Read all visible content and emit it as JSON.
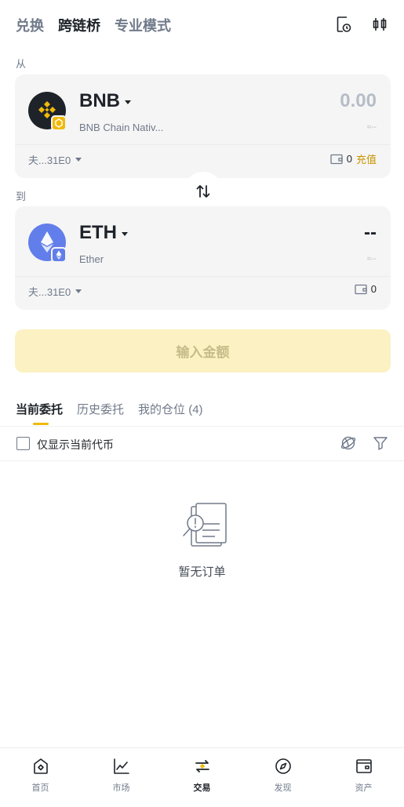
{
  "header": {
    "tabs": [
      {
        "label": "兑换",
        "active": false
      },
      {
        "label": "跨链桥",
        "active": true
      },
      {
        "label": "专业模式",
        "active": false
      }
    ],
    "icons": [
      "order-history-icon",
      "candlestick-chart-icon"
    ]
  },
  "from": {
    "label": "从",
    "symbol": "BNB",
    "chain_name": "BNB Chain Nativ...",
    "amount": "0.00",
    "approx": "≈--",
    "address": "夫...31E0",
    "balance": "0",
    "deposit_label": "充值",
    "icon": "bnb-coin-icon"
  },
  "to": {
    "label": "到",
    "symbol": "ETH",
    "chain_name": "Ether",
    "amount": "--",
    "approx": "≈--",
    "address": "夫...31E0",
    "balance": "0",
    "icon": "eth-coin-icon"
  },
  "swap_icon": "swap-arrows-icon",
  "cta_label": "输入金额",
  "orders": {
    "tabs": [
      {
        "label": "当前委托",
        "active": true
      },
      {
        "label": "历史委托",
        "active": false
      },
      {
        "label": "我的仓位 (4)",
        "active": false
      }
    ],
    "filter_label": "仅显示当前代币",
    "empty_text": "暂无订单"
  },
  "bottom_nav": [
    {
      "label": "首页",
      "icon": "home-icon",
      "active": false
    },
    {
      "label": "市场",
      "icon": "market-chart-icon",
      "active": false
    },
    {
      "label": "交易",
      "icon": "trade-icon",
      "active": true
    },
    {
      "label": "发现",
      "icon": "discover-icon",
      "active": false
    },
    {
      "label": "资产",
      "icon": "wallet-icon",
      "active": false
    }
  ],
  "colors": {
    "accent": "#f0b90b",
    "deposit": "#c99400",
    "bnb": "#f0b90b",
    "eth": "#627eea"
  }
}
